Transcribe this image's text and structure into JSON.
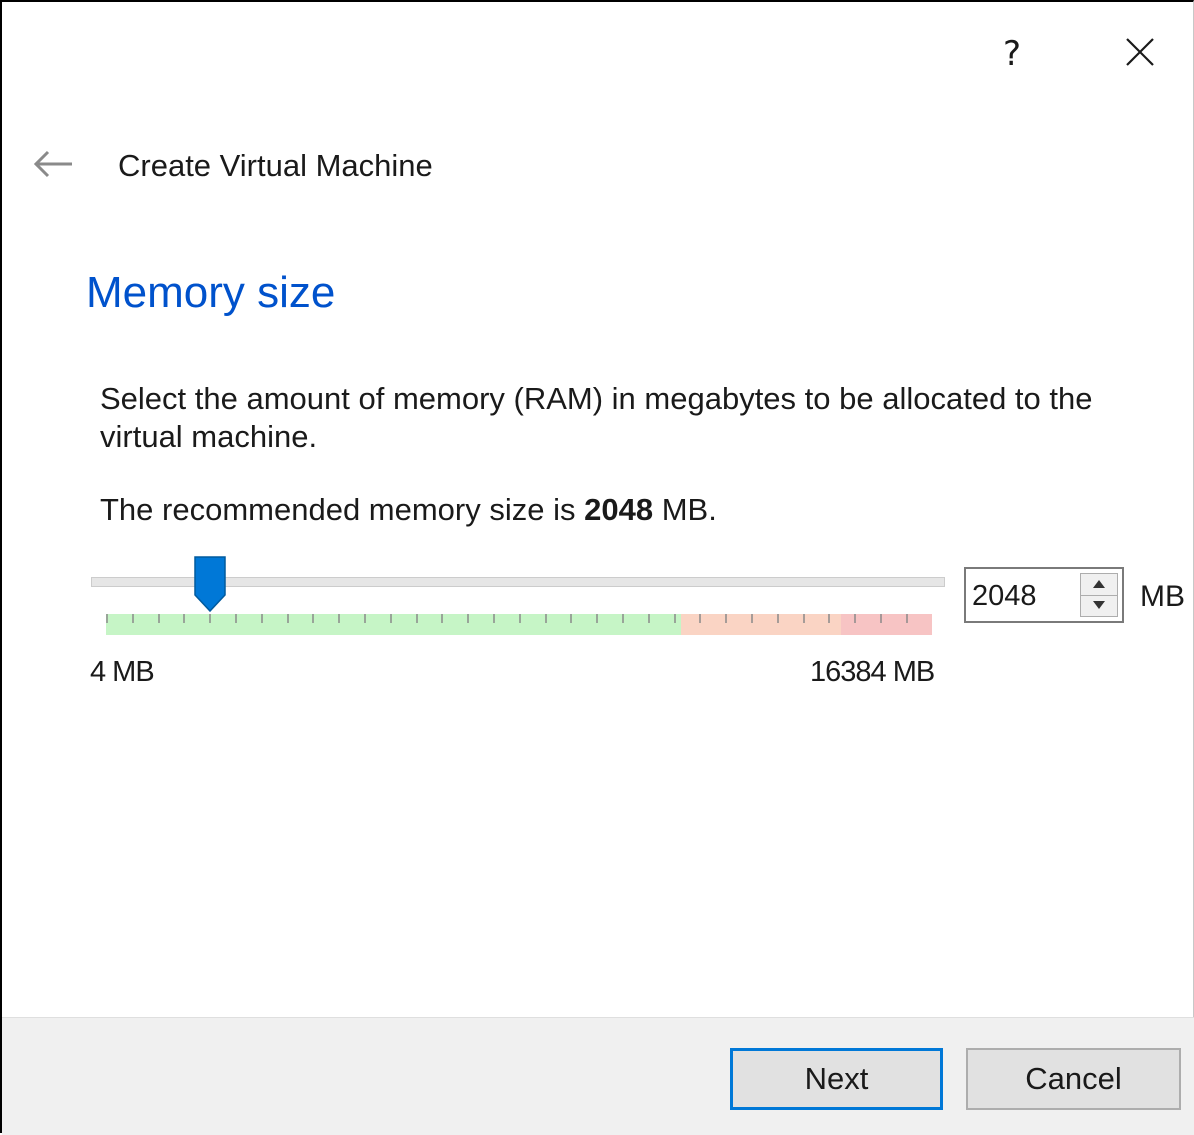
{
  "titlebar": {
    "help_label": "?",
    "close_icon": "close-icon"
  },
  "wizard": {
    "back_icon": "back-arrow-icon",
    "title": "Create Virtual Machine"
  },
  "page": {
    "heading": "Memory size",
    "description": "Select the amount of memory (RAM) in megabytes to be allocated to the virtual machine.",
    "recommend_prefix": "The recommended memory size is ",
    "recommend_value": "2048",
    "recommend_suffix": " MB."
  },
  "memory": {
    "value": "2048",
    "unit": "MB",
    "min_label": "4 MB",
    "max_label": "16384 MB",
    "min_mb": 4,
    "max_mb": 16384,
    "current_mb": 2048,
    "zones": {
      "safe_color": "#c6f5c6",
      "warning_color": "#fad4c4",
      "danger_color": "#f7c4c4"
    },
    "thumb_color": "#0078d7"
  },
  "footer": {
    "next_label": "Next",
    "cancel_label": "Cancel"
  }
}
